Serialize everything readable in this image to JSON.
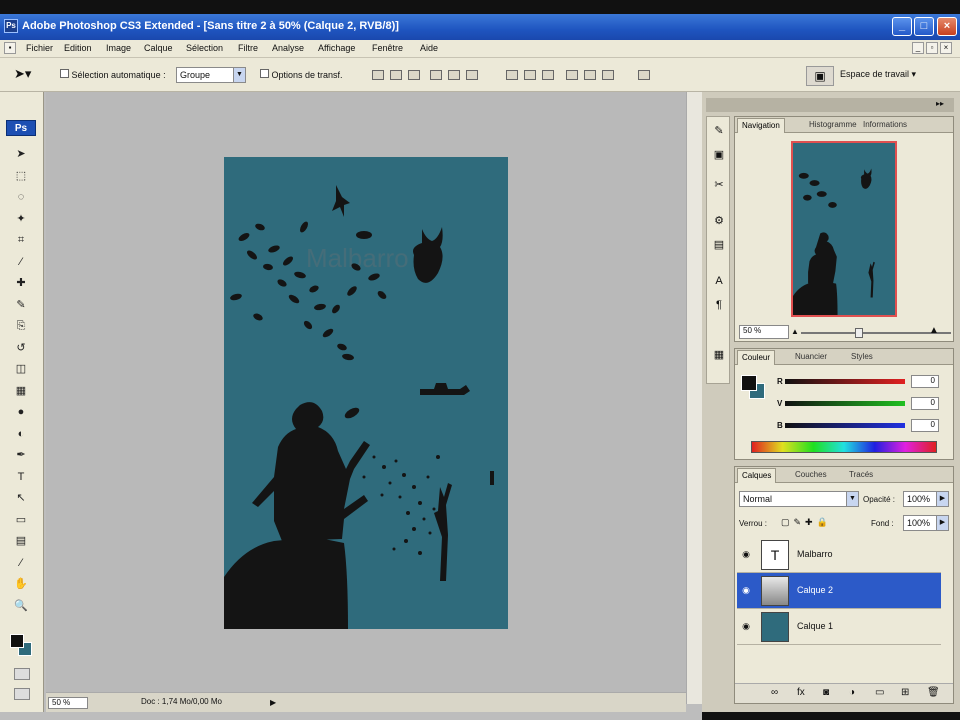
{
  "window": {
    "title": "Adobe Photoshop CS3 Extended - [Sans titre 2 à 50% (Calque 2, RVB/8)]",
    "logo_text": "Ps",
    "buttons": {
      "minimize": "_",
      "maximize": "□",
      "close": "×"
    }
  },
  "menubar": {
    "items": [
      "Fichier",
      "Edition",
      "Image",
      "Calque",
      "Sélection",
      "Filtre",
      "Analyse",
      "Affichage",
      "Fenêtre",
      "Aide"
    ]
  },
  "options": {
    "auto_select_label": "Sélection automatique :",
    "auto_select_value": "Groupe",
    "transform_label": "Options de transf.",
    "workspace_label": "Espace de travail ▾"
  },
  "toolbox": {
    "logo": "Ps",
    "tools": [
      "move-icon",
      "marquee-icon",
      "lasso-icon",
      "magic-wand-icon",
      "crop-icon",
      "eyedropper-icon",
      "healing-icon",
      "brush-icon",
      "clone-icon",
      "history-brush-icon",
      "eraser-icon",
      "gradient-icon",
      "blur-icon",
      "dodge-icon",
      "pen-icon",
      "type-icon",
      "path-select-icon",
      "shape-icon",
      "notes-icon",
      "eyedropper2-icon",
      "hand-icon",
      "zoom-icon"
    ],
    "tool_glyphs": [
      "➤",
      "⬚",
      "◌",
      "✦",
      "⌗",
      "⁄",
      "✚",
      "✎",
      "⎘",
      "↺",
      "◫",
      "▦",
      "●",
      "◐",
      "✒",
      "T",
      "↖",
      "▭",
      "▤",
      "⁄",
      "✋",
      "🔍"
    ]
  },
  "document": {
    "watermark": "Malbarro",
    "canvas_color": "#2f6b7c",
    "silhouette_color": "#141414"
  },
  "status": {
    "zoom": "50 %",
    "doc_info": "Doc : 1,74 Mo/0,00 Mo"
  },
  "navigator": {
    "tabs": [
      "Navigation",
      "Histogramme",
      "Informations"
    ],
    "zoom": "50 %"
  },
  "color_panel": {
    "tabs": [
      "Couleur",
      "Nuancier",
      "Styles"
    ],
    "channels": [
      {
        "label": "R",
        "value": "0",
        "color": "#d02020"
      },
      {
        "label": "V",
        "value": "0",
        "color": "#20a020"
      },
      {
        "label": "B",
        "value": "0",
        "color": "#2030c0"
      }
    ],
    "foreground": "#111111",
    "background": "#2f6b7c"
  },
  "layers_panel": {
    "tabs": [
      "Calques",
      "Couches",
      "Tracés"
    ],
    "blend_mode": "Normal",
    "opacity_label": "Opacité :",
    "opacity_value": "100%",
    "lock_label": "Verrou :",
    "fill_label": "Fond :",
    "fill_value": "100%",
    "layers": [
      {
        "name": "Malbarro",
        "thumb": "T",
        "selected": false
      },
      {
        "name": "Calque 2",
        "thumb": "",
        "selected": true
      },
      {
        "name": "Calque 1",
        "thumb": "",
        "selected": false
      }
    ],
    "footer_icons": [
      "link-icon",
      "fx-icon",
      "mask-icon",
      "adjustment-icon",
      "group-icon",
      "new-layer-icon",
      "trash-icon"
    ],
    "footer_glyphs": [
      "∞",
      "fx",
      "◙",
      "◑",
      "▭",
      "⊞",
      "🗑"
    ]
  }
}
